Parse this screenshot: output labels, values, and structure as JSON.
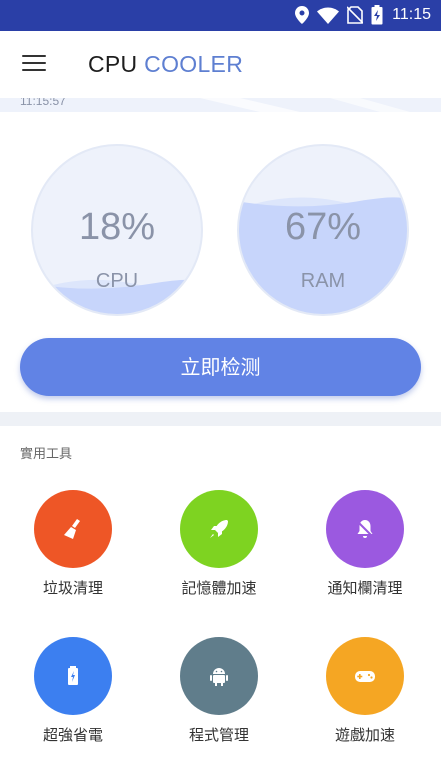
{
  "status_bar": {
    "time": "11:15",
    "background": "#2a3fa7",
    "icons": [
      "location-icon",
      "wifi-icon",
      "no-sim-icon",
      "battery-charging-icon"
    ]
  },
  "app_bar": {
    "title_part1": "CPU",
    "title_part2": "COOLER",
    "title_part2_color": "#5e7fd1",
    "menu_icon": "hamburger-menu-icon"
  },
  "banner": {
    "time_text": "11:15:57"
  },
  "gauges": {
    "cpu": {
      "percent_text": "18%",
      "label": "CPU",
      "fill_fraction": 0.18
    },
    "ram": {
      "percent_text": "67%",
      "label": "RAM",
      "fill_fraction": 0.67
    }
  },
  "detect_button": {
    "label": "立即检测",
    "color": "#6183e5"
  },
  "tools": {
    "section_title": "實用工具",
    "items": [
      {
        "label": "垃圾清理",
        "icon": "broom-icon",
        "color": "#ee5626"
      },
      {
        "label": "記憶體加速",
        "icon": "rocket-icon",
        "color": "#7ed321"
      },
      {
        "label": "通知欄清理",
        "icon": "bell-off-icon",
        "color": "#9b59e0"
      },
      {
        "label": "超強省電",
        "icon": "battery-saver-icon",
        "color": "#3c7ff0"
      },
      {
        "label": "程式管理",
        "icon": "android-icon",
        "color": "#607d8b"
      },
      {
        "label": "遊戲加速",
        "icon": "gamepad-icon",
        "color": "#f5a623"
      }
    ]
  }
}
